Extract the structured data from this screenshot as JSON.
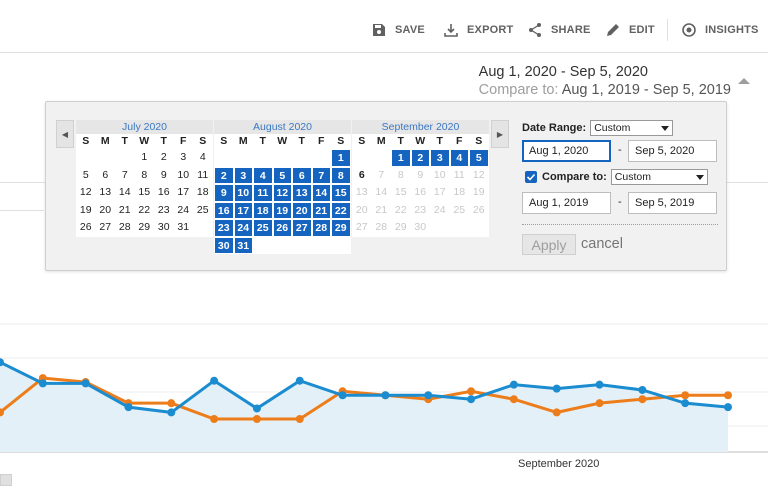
{
  "toolbar": {
    "save": "SAVE",
    "export": "EXPORT",
    "share": "SHARE",
    "edit": "EDIT",
    "insights": "INSIGHTS"
  },
  "summary": {
    "range": "Aug 1, 2020 - Sep 5, 2020",
    "compare_prefix": "Compare to:",
    "compare_range": "Aug 1, 2019 - Sep 5, 2019"
  },
  "calendar": {
    "weekdays": [
      "S",
      "M",
      "T",
      "W",
      "T",
      "F",
      "S"
    ],
    "months": [
      {
        "title": "July 2020",
        "offset": 3,
        "days": 31,
        "state": "normal"
      },
      {
        "title": "August 2020",
        "offset": 6,
        "days": 31,
        "state": "selected"
      },
      {
        "title": "September 2020",
        "offset": 2,
        "days": 30,
        "selected_through": 5,
        "today": 6,
        "state": "partial"
      }
    ]
  },
  "controls": {
    "date_range_label": "Date Range:",
    "date_range_option": "Custom",
    "start_date": "Aug 1, 2020",
    "end_date": "Sep 5, 2020",
    "compare_label": "Compare to:",
    "compare_checked": true,
    "compare_option": "Custom",
    "compare_start": "Aug 1, 2019",
    "compare_end": "Sep 5, 2019",
    "dash": "-",
    "apply": "Apply",
    "cancel": "cancel"
  },
  "chart_data": {
    "type": "line",
    "x_label_visible": "September 2020",
    "series": [
      {
        "color": "#1a8ccf",
        "values": [
          68,
          52,
          52,
          34,
          30,
          54,
          33,
          54,
          43,
          43,
          43,
          40,
          51,
          48,
          51,
          47,
          37,
          34
        ]
      },
      {
        "color": "#ed7d1a",
        "values": [
          30,
          56,
          53,
          37,
          37,
          25,
          25,
          25,
          46,
          43,
          40,
          46,
          40,
          30,
          37,
          40,
          43,
          43
        ]
      }
    ],
    "ylim": [
      0,
      100
    ]
  },
  "colors": {
    "accent": "#1565c0",
    "series_blue": "#1a8ccf",
    "series_orange": "#ed7d1a",
    "area_fill": "#e3f0f8"
  }
}
